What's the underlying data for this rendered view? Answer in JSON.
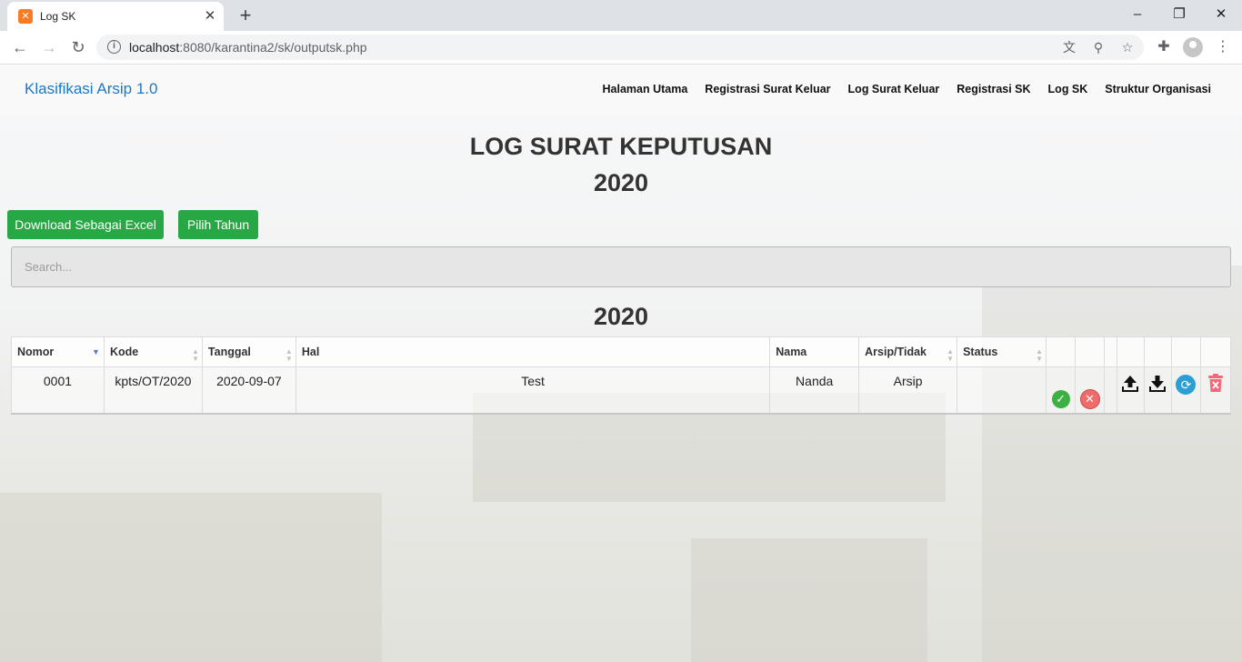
{
  "browser": {
    "tab_title": "Log SK",
    "new_tab_label": "+",
    "url_host": "localhost",
    "url_rest": ":8080/karantina2/sk/outputsk.php"
  },
  "navbar": {
    "brand": "Klasifikasi Arsip 1.0",
    "links": [
      "Halaman Utama",
      "Registrasi Surat Keluar",
      "Log Surat Keluar",
      "Registrasi SK",
      "Log SK",
      "Struktur Organisasi"
    ]
  },
  "main": {
    "title": "LOG SURAT KEPUTUSAN",
    "year": "2020",
    "table_year": "2020",
    "download_label": "Download Sebagai Excel",
    "year_button_label": "Pilih Tahun",
    "search_placeholder": "Search..."
  },
  "table": {
    "headers": [
      "Nomor",
      "Kode",
      "Tanggal",
      "Hal",
      "Nama",
      "Arsip/Tidak",
      "Status"
    ],
    "rows": [
      [
        "0001",
        "kpts/OT/2020",
        "2020-09-07",
        "Test",
        "Nanda",
        "Arsip",
        ""
      ]
    ]
  },
  "icons": {
    "approve": "check-circle-icon",
    "reject": "x-circle-icon",
    "upload": "upload-icon",
    "download": "download-icon",
    "refresh": "refresh-icon",
    "delete": "trash-icon"
  },
  "colors": {
    "accent_green": "#28a745",
    "brand_blue": "#1a78c8",
    "delete_red": "#f06a7a"
  }
}
